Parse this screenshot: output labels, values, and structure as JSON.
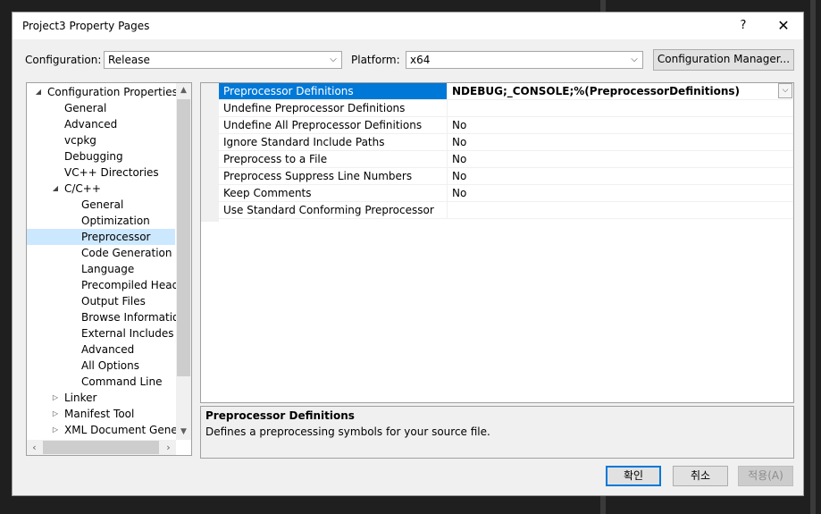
{
  "window": {
    "title": "Project3 Property Pages",
    "help_label": "?",
    "close_label": "✕"
  },
  "config_bar": {
    "configuration_label": "Configuration:",
    "configuration_value": "Release",
    "platform_label": "Platform:",
    "platform_value": "x64",
    "config_manager_label": "Configuration Manager..."
  },
  "tree": {
    "items": [
      {
        "label": "Configuration Properties",
        "expander": "◢"
      },
      {
        "label": "General"
      },
      {
        "label": "Advanced"
      },
      {
        "label": "vcpkg"
      },
      {
        "label": "Debugging"
      },
      {
        "label": "VC++ Directories"
      },
      {
        "label": "C/C++",
        "expander": "◢"
      },
      {
        "label": "General"
      },
      {
        "label": "Optimization"
      },
      {
        "label": "Preprocessor",
        "selected": true
      },
      {
        "label": "Code Generation"
      },
      {
        "label": "Language"
      },
      {
        "label": "Precompiled Heade"
      },
      {
        "label": "Output Files"
      },
      {
        "label": "Browse Information"
      },
      {
        "label": "External Includes"
      },
      {
        "label": "Advanced"
      },
      {
        "label": "All Options"
      },
      {
        "label": "Command Line"
      },
      {
        "label": "Linker",
        "expander": "▷"
      },
      {
        "label": "Manifest Tool",
        "expander": "▷"
      },
      {
        "label": "XML Document Genera",
        "expander": "▷"
      }
    ]
  },
  "grid": {
    "rows": [
      {
        "name": "Preprocessor Definitions",
        "value": "NDEBUG;_CONSOLE;%(PreprocessorDefinitions)"
      },
      {
        "name": "Undefine Preprocessor Definitions",
        "value": ""
      },
      {
        "name": "Undefine All Preprocessor Definitions",
        "value": "No"
      },
      {
        "name": "Ignore Standard Include Paths",
        "value": "No"
      },
      {
        "name": "Preprocess to a File",
        "value": "No"
      },
      {
        "name": "Preprocess Suppress Line Numbers",
        "value": "No"
      },
      {
        "name": "Keep Comments",
        "value": "No"
      },
      {
        "name": "Use Standard Conforming Preprocessor",
        "value": ""
      }
    ]
  },
  "description": {
    "title": "Preprocessor Definitions",
    "text": "Defines a preprocessing symbols for your source file."
  },
  "buttons": {
    "ok": "확인",
    "cancel": "취소",
    "apply": "적용(A)"
  },
  "colors": {
    "selection": "#0078d7",
    "tree_selection": "#cce8ff"
  }
}
